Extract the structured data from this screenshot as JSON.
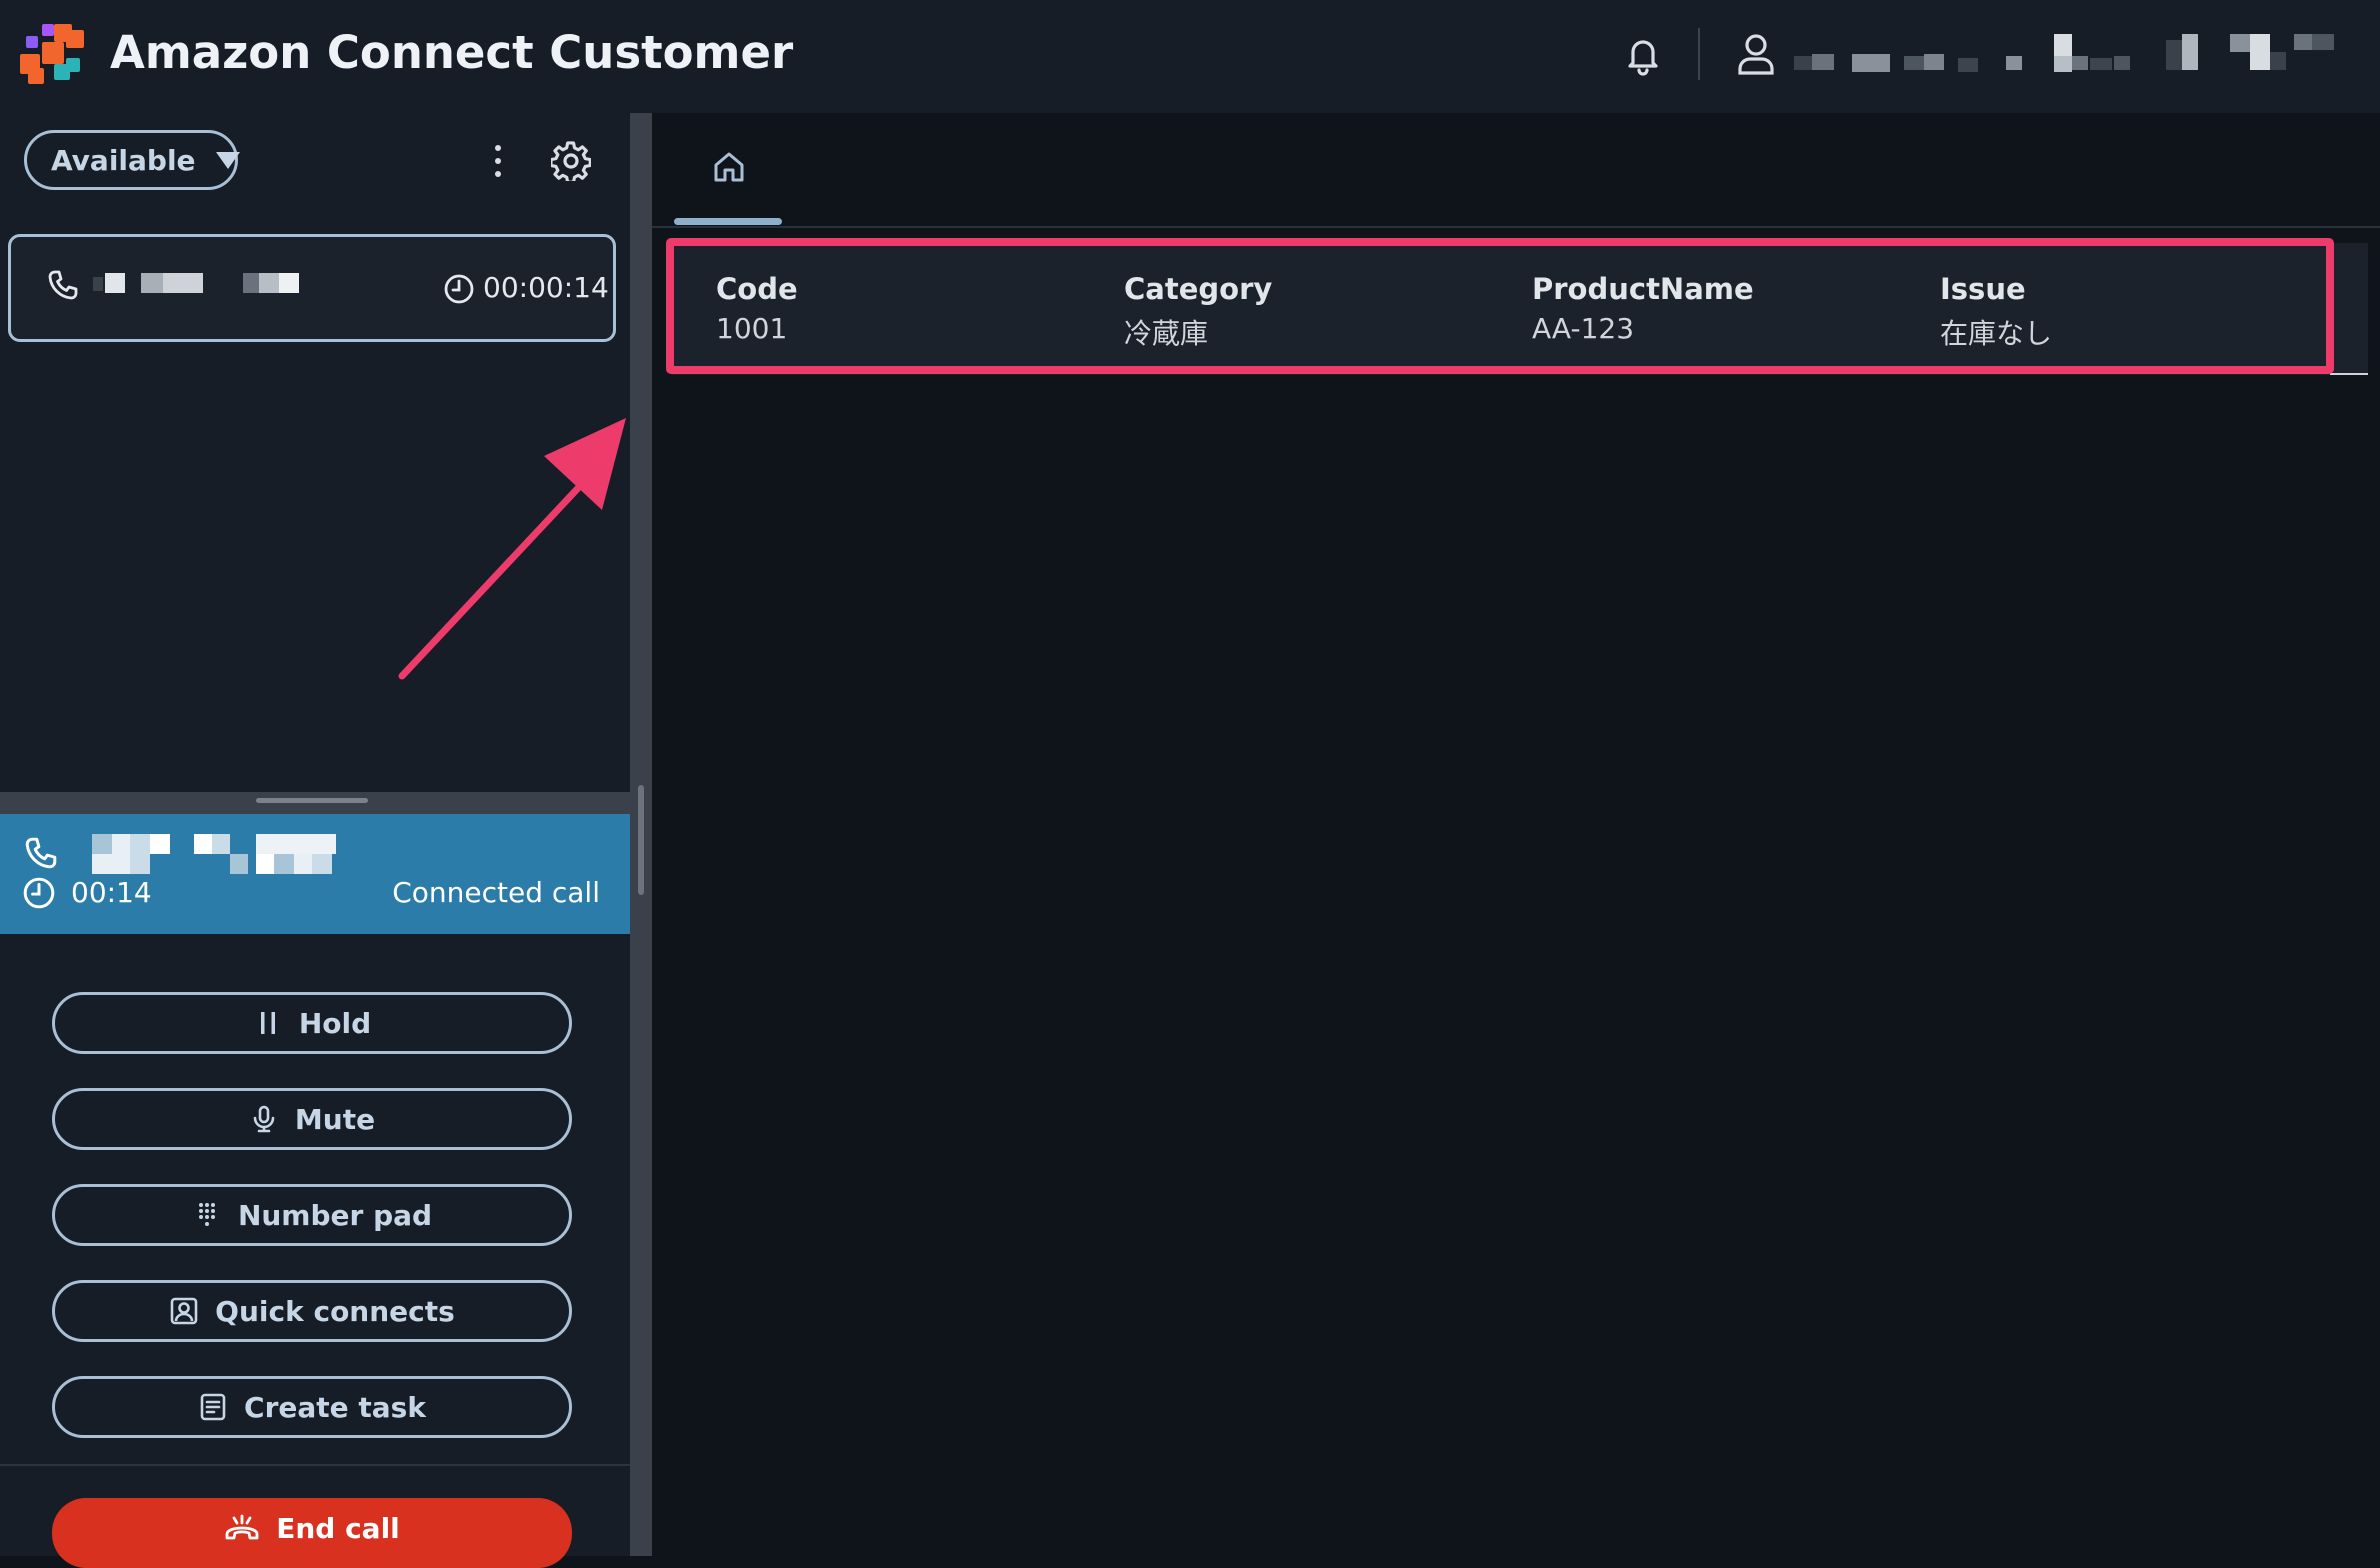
{
  "header": {
    "app_title": "Amazon Connect Customer",
    "brand_colors": [
      "#8b5cf6",
      "#f2652c",
      "#2bb3b7"
    ]
  },
  "agent_status": {
    "label": "Available"
  },
  "contact_card": {
    "timer": "00:00:14"
  },
  "active_call": {
    "elapsed": "00:14",
    "state": "Connected call"
  },
  "actions": {
    "hold": "Hold",
    "mute": "Mute",
    "number_pad": "Number pad",
    "quick_connects": "Quick connects",
    "create_task": "Create task",
    "end_call": "End call"
  },
  "tabs": [
    {
      "icon": "home-icon"
    }
  ],
  "record": {
    "columns": [
      {
        "header": "Code",
        "value": "1001"
      },
      {
        "header": "Category",
        "value": "冷蔵庫"
      },
      {
        "header": "ProductName",
        "value": "AA-123"
      },
      {
        "header": "Issue",
        "value": "在庫なし"
      }
    ]
  },
  "colors": {
    "highlight": "#ed3b6b",
    "call_banner": "#2b7ca9",
    "end_call": "#d8311f"
  }
}
